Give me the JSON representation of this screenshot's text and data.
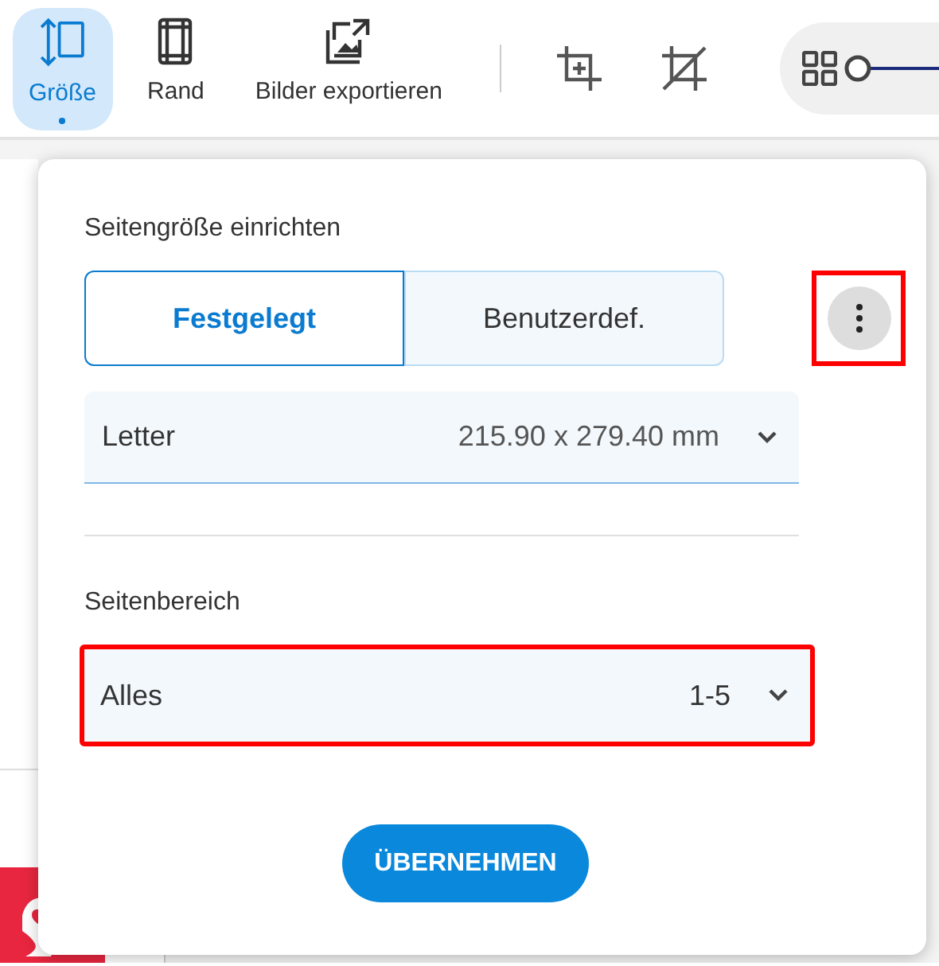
{
  "toolbar": {
    "tools": [
      {
        "label": "Größe",
        "kind": "size",
        "selected": true
      },
      {
        "label": "Rand",
        "kind": "margin",
        "selected": false
      },
      {
        "label": "Bilder exportieren",
        "kind": "export",
        "selected": false
      }
    ],
    "icon_tools": [
      {
        "kind": "crop"
      },
      {
        "kind": "uncrop"
      }
    ],
    "zoom": {
      "level": 0
    }
  },
  "panel": {
    "size_title": "Seitengröße einrichten",
    "modes": [
      {
        "label": "Festgelegt",
        "selected": true
      },
      {
        "label": "Benutzerdef.",
        "selected": false
      }
    ],
    "more_highlighted": true,
    "paper": {
      "name": "Letter",
      "dimensions": "215.90 x 279.40 mm"
    },
    "range_title": "Seitenbereich",
    "range": {
      "value": "Alles",
      "pages": "1-5",
      "highlighted": true
    },
    "apply_button": "ÜBERNEHMEN"
  }
}
